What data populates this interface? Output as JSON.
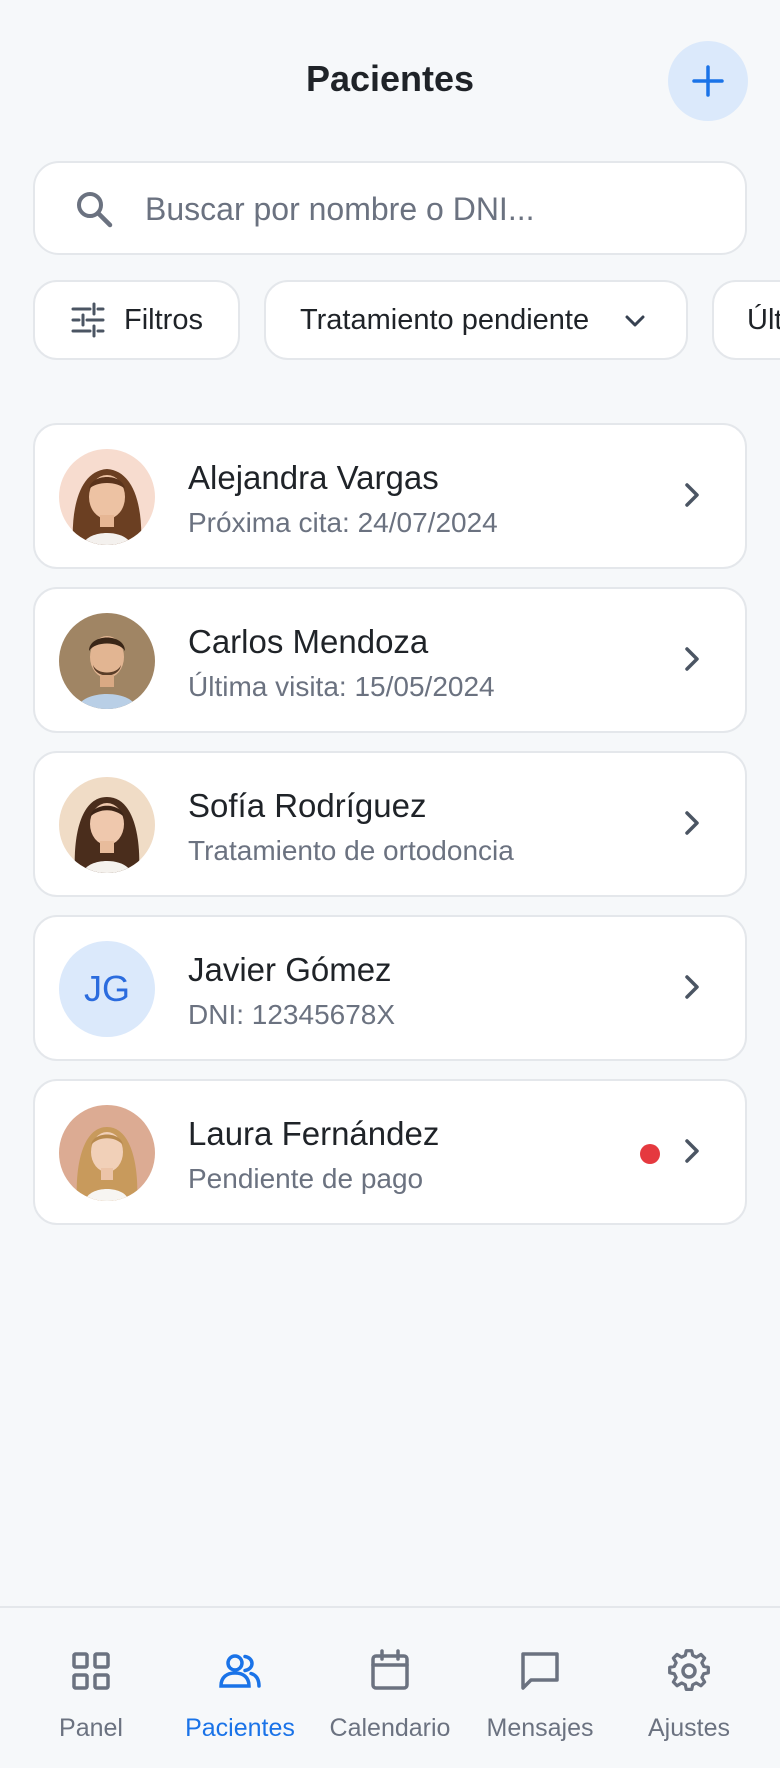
{
  "header": {
    "title": "Pacientes",
    "add_icon": "plus-icon",
    "accent": "#1a73e8"
  },
  "search": {
    "placeholder": "Buscar por nombre o DNI...",
    "value": "",
    "icon": "search-icon"
  },
  "filters": {
    "filtros_label": "Filtros",
    "tratamiento_label": "Tratamiento pendiente",
    "ultima_label": "Últ"
  },
  "patients": [
    {
      "name": "Alejandra Vargas",
      "detail": "Próxima cita: 24/07/2024",
      "avatar": "photo",
      "alert": false
    },
    {
      "name": "Carlos Mendoza",
      "detail": "Última visita: 15/05/2024",
      "avatar": "photo",
      "alert": false
    },
    {
      "name": "Sofía Rodríguez",
      "detail": "Tratamiento de ortodoncia",
      "avatar": "photo",
      "alert": false
    },
    {
      "name": "Javier Gómez",
      "detail": "DNI: 12345678X",
      "avatar": "initials",
      "initials": "JG",
      "alert": false
    },
    {
      "name": "Laura Fernández",
      "detail": "Pendiente de pago",
      "avatar": "photo",
      "alert": true,
      "alert_color": "#e5393f"
    }
  ],
  "nav": [
    {
      "label": "Panel",
      "icon": "grid-icon",
      "active": false
    },
    {
      "label": "Pacientes",
      "icon": "users-icon",
      "active": true
    },
    {
      "label": "Calendario",
      "icon": "calendar-icon",
      "active": false
    },
    {
      "label": "Mensajes",
      "icon": "message-icon",
      "active": false
    },
    {
      "label": "Ajustes",
      "icon": "gear-icon",
      "active": false
    }
  ]
}
